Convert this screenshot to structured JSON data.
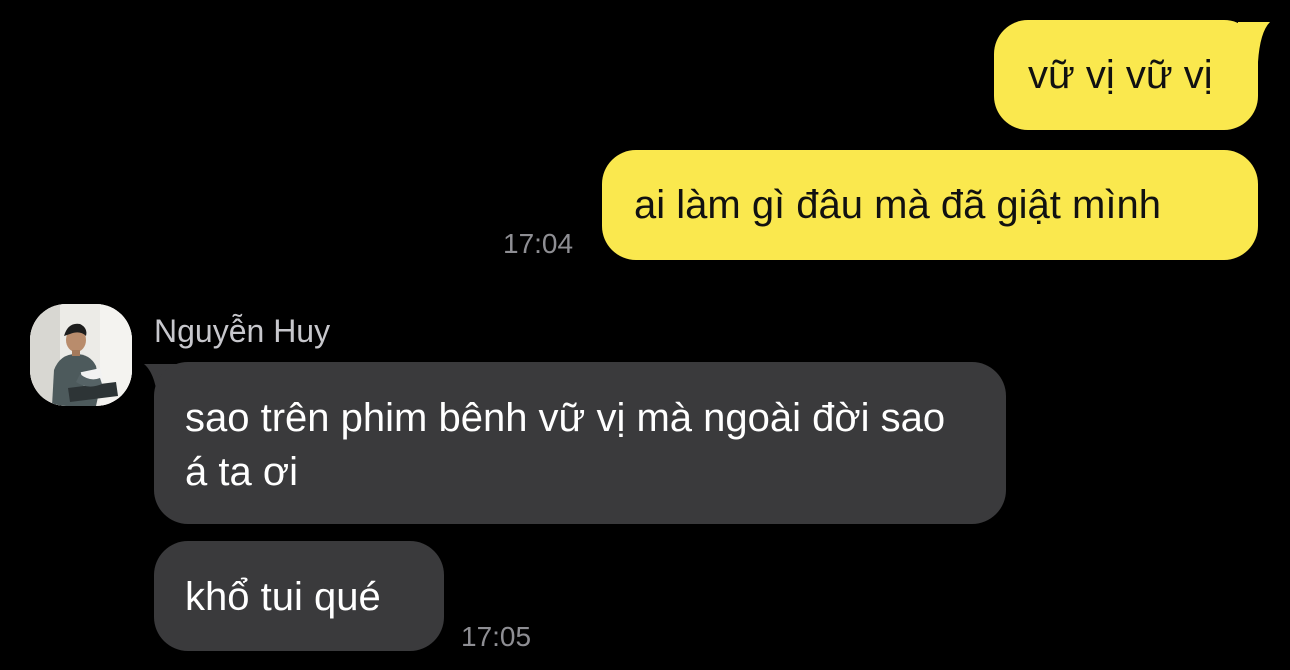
{
  "outgoing": [
    {
      "text": "vữ vị vữ vị"
    },
    {
      "text": "ai làm gì đâu mà đã giật mình",
      "time": "17:04"
    }
  ],
  "incoming": {
    "sender_name": "Nguyễn Huy",
    "avatar_icon": "user-photo-avatar",
    "messages": [
      {
        "text": "sao trên phim bênh vữ vị mà ngoài đời sao á ta ơi"
      },
      {
        "text": "khổ tui qué",
        "time": "17:05"
      }
    ]
  },
  "colors": {
    "background": "#000000",
    "outgoing_bubble": "#fae84e",
    "incoming_bubble": "#3a3a3c",
    "timestamp": "#8e8e93",
    "sender_name": "#c7c7cc"
  }
}
